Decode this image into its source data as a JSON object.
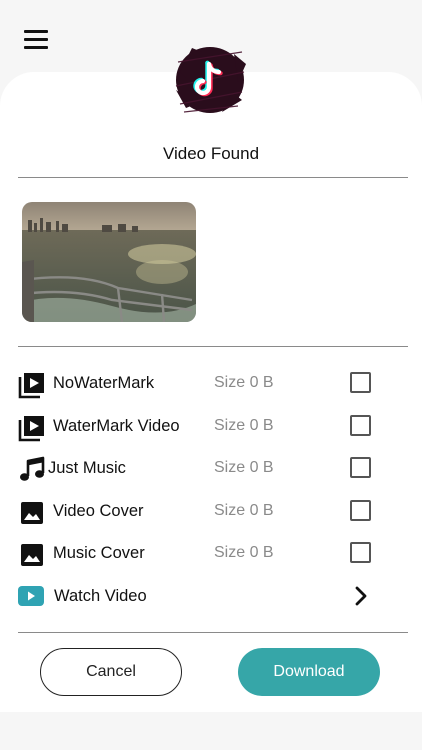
{
  "header": {
    "menu_icon": "hamburger-menu-icon",
    "logo_icon": "tiktok-logo-icon"
  },
  "result": {
    "title": "Video Found",
    "thumbnail": "video-thumbnail-sea-from-boat"
  },
  "options": [
    {
      "label": "NoWaterMark",
      "size": "Size 0 B",
      "icon": "video-library-icon",
      "checked": false
    },
    {
      "label": "WaterMark Video",
      "size": "Size 0 B",
      "icon": "video-library-icon",
      "checked": false
    },
    {
      "label": "Just Music",
      "size": "Size 0 B",
      "icon": "music-note-icon",
      "checked": false
    },
    {
      "label": "Video Cover",
      "size": "Size 0 B",
      "icon": "image-icon",
      "checked": false
    },
    {
      "label": "Music Cover",
      "size": "Size 0 B",
      "icon": "image-icon",
      "checked": false
    }
  ],
  "watch": {
    "label": "Watch Video",
    "icon": "youtube-play-icon",
    "arrow": "chevron-right-icon"
  },
  "actions": {
    "cancel_label": "Cancel",
    "download_label": "Download"
  },
  "colors": {
    "accent": "#36a6a8",
    "watch_icon": "#2fa3b3"
  }
}
